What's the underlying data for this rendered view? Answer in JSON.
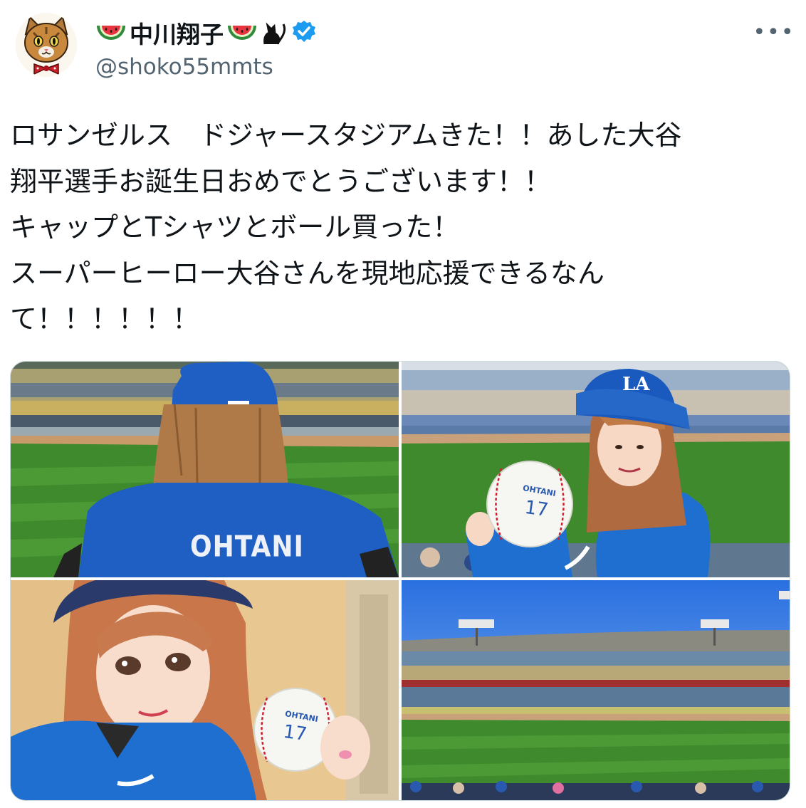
{
  "author": {
    "display_name": "中川翔子",
    "handle": "@shoko55mmts",
    "verified": true,
    "name_emoji_left": "watermelon-icon",
    "name_emoji_right": "watermelon-icon",
    "name_emoji_extra": "black-cat-icon",
    "verified_color": "#1d9bf0"
  },
  "more_menu": {
    "label": "•••"
  },
  "tweet": {
    "lines": [
      "ロサンゼルス　ドジャースタジアムきた！！あした大谷",
      "翔平選手お誕生日おめでとうございます！！",
      "キャップとTシャツとボール買った！",
      "スーパーヒーロー大谷さんを現地応援できるなん",
      "て！！！！！！"
    ]
  },
  "media": {
    "photos": [
      {
        "jersey_name": "OHTANI"
      },
      {
        "ball_name": "OHTANI",
        "ball_number": "17"
      },
      {
        "ball_name": "OHTANI",
        "ball_number": "17"
      },
      {}
    ]
  },
  "colors": {
    "text": "#0f1419",
    "secondary": "#536471",
    "dodger_blue": "#1f5fc4",
    "grass": "#4a8a2e"
  }
}
